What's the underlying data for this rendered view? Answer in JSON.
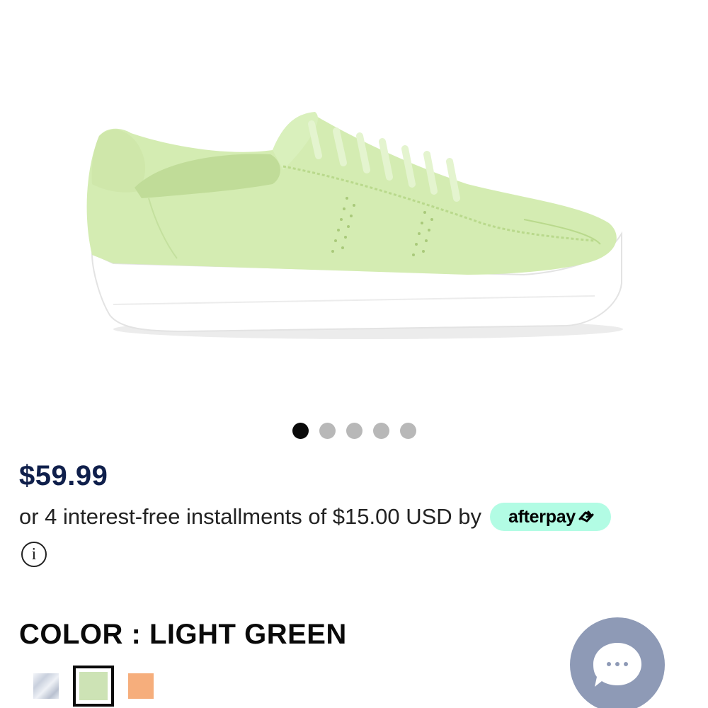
{
  "product": {
    "image_alt": "Light green leather sneaker",
    "carousel": {
      "dots": 5,
      "active_index": 0
    }
  },
  "pricing": {
    "price": "$59.99",
    "installments_text": "or 4 interest-free installments of $15.00 USD by",
    "afterpay_label": "afterpay",
    "info_glyph": "i"
  },
  "color": {
    "heading": "COLOR : LIGHT GREEN",
    "swatches": [
      {
        "name": "marble-white",
        "color": "#dfe4ee",
        "selected": false
      },
      {
        "name": "light-green",
        "color": "#cde3b5",
        "selected": true
      },
      {
        "name": "peach",
        "color": "#f6ae7c",
        "selected": false
      }
    ]
  },
  "colors": {
    "price": "#0f1f4b",
    "afterpay_mint": "#b2fce4",
    "chat_button": "#8e9ab6"
  },
  "icons": {
    "info": "info-circle-icon",
    "chat": "chat-bubble-icon",
    "afterpay_logo": "afterpay-arrows-icon"
  }
}
